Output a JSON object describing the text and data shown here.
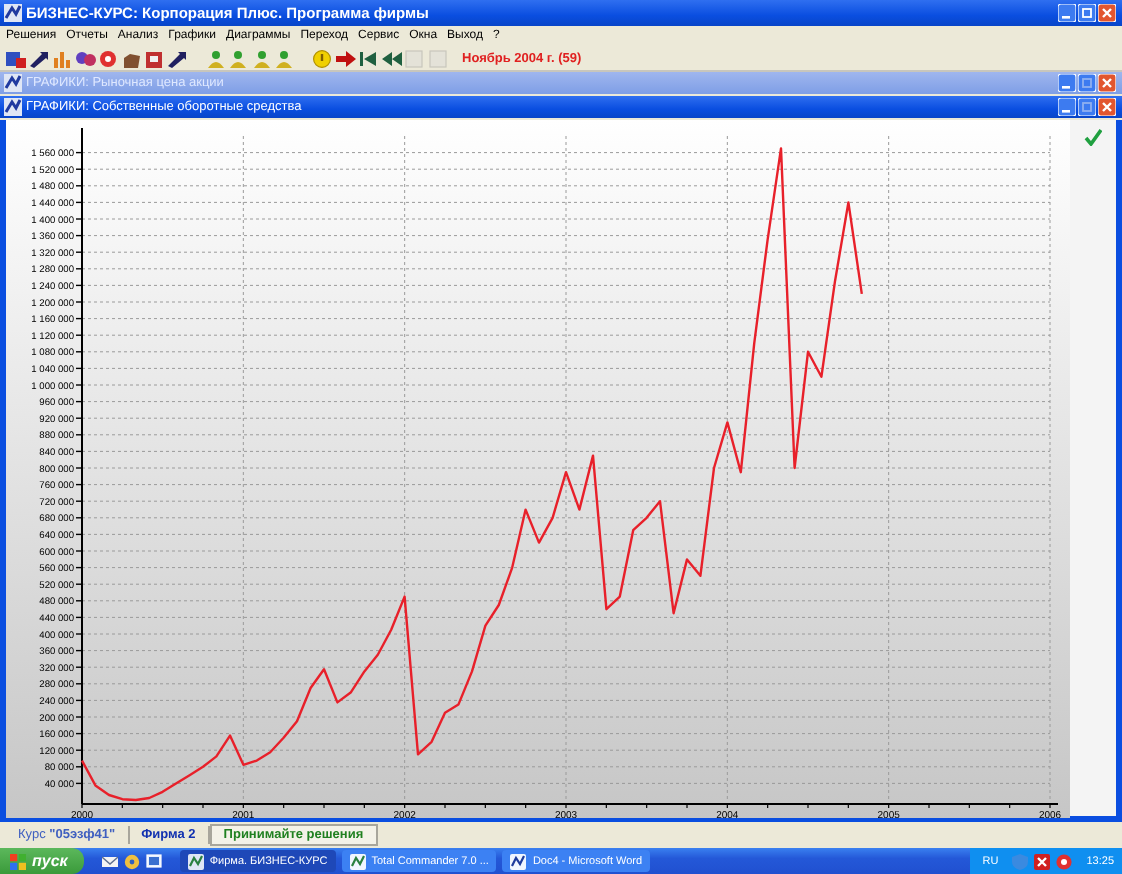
{
  "app": {
    "title": "БИЗНЕС-КУРС: Корпорация Плюс. Программа фирмы"
  },
  "menu": [
    "Решения",
    "Отчеты",
    "Анализ",
    "Графики",
    "Диаграммы",
    "Переход",
    "Сервис",
    "Окна",
    "Выход",
    "?"
  ],
  "toolbar": {
    "period": "Ноябрь 2004 г. (59)"
  },
  "windows": [
    {
      "title": "ГРАФИКИ: Рыночная цена акции",
      "active": false
    },
    {
      "title": "ГРАФИКИ: Собственные оборотные средства",
      "active": true,
      "chart_data": {
        "type": "line",
        "x": [
          2000,
          2000.083,
          2000.167,
          2000.25,
          2000.333,
          2000.417,
          2000.5,
          2000.583,
          2000.667,
          2000.75,
          2000.833,
          2000.917,
          2001,
          2001.083,
          2001.167,
          2001.25,
          2001.333,
          2001.417,
          2001.5,
          2001.583,
          2001.667,
          2001.75,
          2001.833,
          2001.917,
          2002,
          2002.083,
          2002.167,
          2002.25,
          2002.333,
          2002.417,
          2002.5,
          2002.583,
          2002.667,
          2002.75,
          2002.833,
          2002.917,
          2003,
          2003.083,
          2003.167,
          2003.25,
          2003.333,
          2003.417,
          2003.5,
          2003.583,
          2003.667,
          2003.75,
          2003.833,
          2003.917,
          2004,
          2004.083,
          2004.167,
          2004.25,
          2004.333,
          2004.417,
          2004.5,
          2004.583,
          2004.667,
          2004.75,
          2004.833
        ],
        "grid": true,
        "series": [
          {
            "color": "#e8202a",
            "values": [
              95000,
              35000,
              12000,
              2000,
              0,
              5000,
              20000,
              40000,
              60000,
              80000,
              105000,
              155000,
              85000,
              95000,
              115000,
              150000,
              190000,
              270000,
              315000,
              235000,
              260000,
              310000,
              350000,
              410000,
              490000,
              110000,
              140000,
              210000,
              230000,
              310000,
              420000,
              470000,
              560000,
              700000,
              620000,
              680000,
              790000,
              700000,
              830000,
              460000,
              490000,
              650000,
              680000,
              720000,
              450000,
              580000,
              540000,
              800000,
              910000,
              790000,
              1100000,
              1350000,
              1570000,
              800000,
              1080000,
              1020000,
              1250000,
              1440000,
              1220000
            ]
          }
        ],
        "xlim": [
          2000,
          2006
        ],
        "ylim": [
          0,
          1600000
        ],
        "xticks": [
          2000,
          2001,
          2002,
          2003,
          2004,
          2005,
          2006
        ],
        "yticks": [
          {
            "value": 40000,
            "label": "40 000"
          },
          {
            "value": 80000,
            "label": "80 000"
          },
          {
            "value": 120000,
            "label": "120 000"
          },
          {
            "value": 160000,
            "label": "160 000"
          },
          {
            "value": 200000,
            "label": "200 000"
          },
          {
            "value": 240000,
            "label": "240 000"
          },
          {
            "value": 280000,
            "label": "280 000"
          },
          {
            "value": 320000,
            "label": "320 000"
          },
          {
            "value": 360000,
            "label": "360 000"
          },
          {
            "value": 400000,
            "label": "400 000"
          },
          {
            "value": 440000,
            "label": "440 000"
          },
          {
            "value": 480000,
            "label": "480 000"
          },
          {
            "value": 520000,
            "label": "520 000"
          },
          {
            "value": 560000,
            "label": "560 000"
          },
          {
            "value": 600000,
            "label": "600 000"
          },
          {
            "value": 640000,
            "label": "640 000"
          },
          {
            "value": 680000,
            "label": "680 000"
          },
          {
            "value": 720000,
            "label": "720 000"
          },
          {
            "value": 760000,
            "label": "760 000"
          },
          {
            "value": 800000,
            "label": "800 000"
          },
          {
            "value": 840000,
            "label": "840 000"
          },
          {
            "value": 880000,
            "label": "880 000"
          },
          {
            "value": 920000,
            "label": "920 000"
          },
          {
            "value": 960000,
            "label": "960 000"
          },
          {
            "value": 1000000,
            "label": "1 000 000"
          },
          {
            "value": 1040000,
            "label": "1 040 000"
          },
          {
            "value": 1080000,
            "label": "1 080 000"
          },
          {
            "value": 1120000,
            "label": "1 120 000"
          },
          {
            "value": 1160000,
            "label": "1 160 000"
          },
          {
            "value": 1200000,
            "label": "1 200 000"
          },
          {
            "value": 1240000,
            "label": "1 240 000"
          },
          {
            "value": 1280000,
            "label": "1 280 000"
          },
          {
            "value": 1320000,
            "label": "1 320 000"
          },
          {
            "value": 1360000,
            "label": "1 360 000"
          },
          {
            "value": 1400000,
            "label": "1 400 000"
          },
          {
            "value": 1440000,
            "label": "1 440 000"
          },
          {
            "value": 1480000,
            "label": "1 480 000"
          },
          {
            "value": 1520000,
            "label": "1 520 000"
          },
          {
            "value": 1560000,
            "label": "1 560 000"
          }
        ]
      }
    }
  ],
  "status_bar": [
    {
      "text": "Курс **\"05эзф41\"**",
      "kind": "course"
    },
    {
      "text": "Фирма 2",
      "kind": "firm"
    },
    {
      "text": "Принимайте решения",
      "kind": "message"
    }
  ],
  "taskbar": {
    "start": "пуск",
    "tasks": [
      {
        "label": "Фирма. БИЗНЕС-КУРС",
        "selected": true
      },
      {
        "label": "Total Commander 7.0 ...",
        "selected": false
      },
      {
        "label": "Doc4 - Microsoft Word",
        "selected": false
      }
    ],
    "language": "RU",
    "clock": "13:25"
  }
}
